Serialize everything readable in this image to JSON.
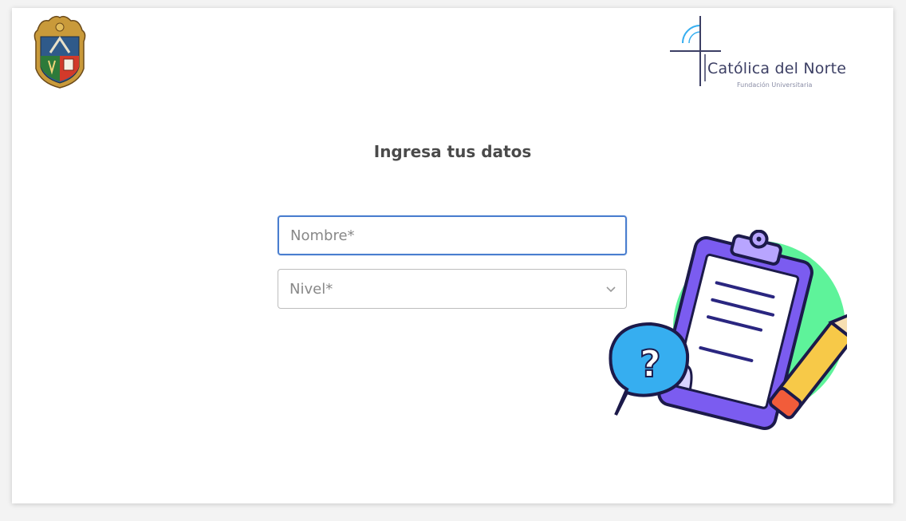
{
  "branding": {
    "crest_icon": "university-crest-icon",
    "logo_icon": "catolica-del-norte-cross-icon",
    "logo_name": "Católica del Norte",
    "logo_subtitle": "Fundación Universitaria"
  },
  "form": {
    "heading": "Ingresa tus datos",
    "name_field": {
      "placeholder": "Nombre*",
      "value": ""
    },
    "level_field": {
      "value": "Nivel*",
      "icon": "chevron-down-icon"
    }
  },
  "illustration": {
    "icon": "clipboard-question-illustration"
  },
  "colors": {
    "accent_border": "#4a7ecf",
    "heading_text": "#4a4a4a",
    "clipboard_purple": "#7b5cf0",
    "circle_green": "#5ef39a",
    "bubble_blue": "#36aef0",
    "pencil_yellow": "#f7c948"
  }
}
